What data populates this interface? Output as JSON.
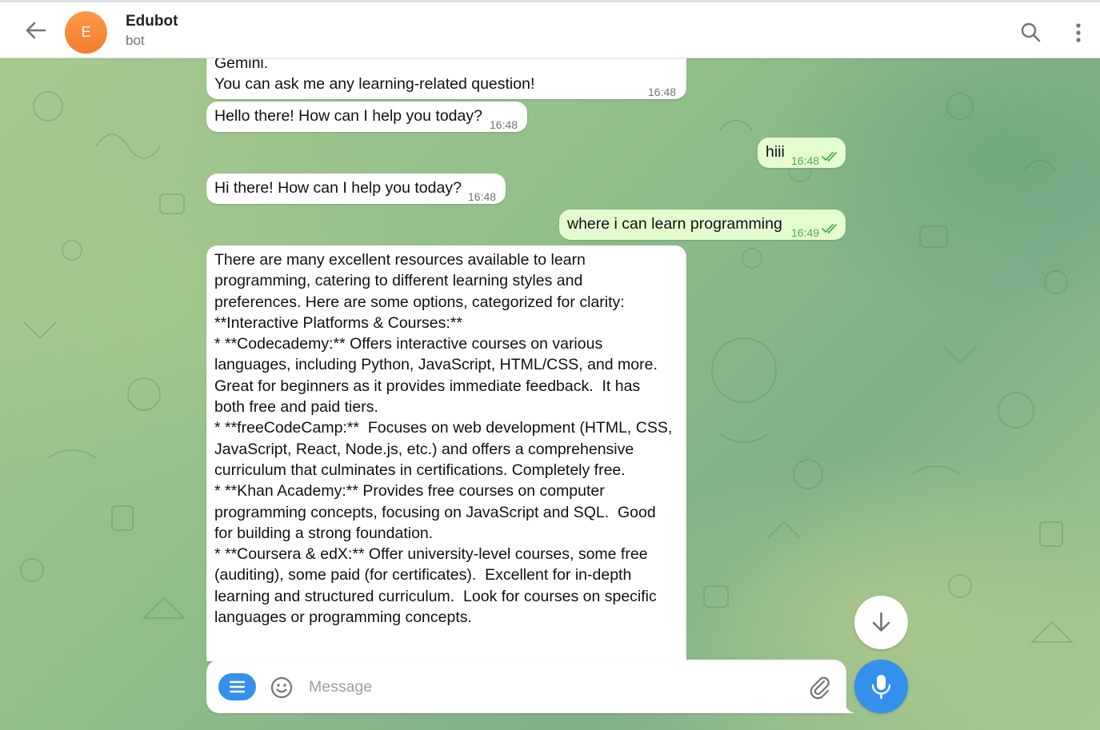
{
  "header": {
    "avatar_letter": "E",
    "title": "Edubot",
    "subtitle": "bot"
  },
  "messages": [
    {
      "direction": "incoming",
      "text_top": "Gemini.",
      "text": "You can ask me any learning-related question!",
      "time": "16:48"
    },
    {
      "direction": "incoming",
      "text": "Hello there! How can I help you today?",
      "time": "16:48"
    },
    {
      "direction": "outgoing",
      "text": "hiii",
      "time": "16:48",
      "status": "read"
    },
    {
      "direction": "incoming",
      "text": "Hi there! How can I help you today?",
      "time": "16:48"
    },
    {
      "direction": "outgoing",
      "text": "where i can learn programming",
      "time": "16:49",
      "status": "read"
    },
    {
      "direction": "incoming",
      "lines": [
        "There are many excellent resources available to learn",
        "programming, catering to different learning styles and",
        "preferences. Here are some options, categorized for clarity:",
        "",
        "**Interactive Platforms & Courses:**",
        "",
        "* **Codecademy:** Offers interactive courses on various",
        "languages, including Python, JavaScript, HTML/CSS, and more.",
        "Great for beginners as it provides immediate feedback.  It has",
        "both free and paid tiers.",
        "* **freeCodeCamp:**  Focuses on web development (HTML, CSS,",
        "JavaScript, React, Node.js, etc.) and offers a comprehensive",
        "curriculum that culminates in certifications. Completely free.",
        "* **Khan Academy:** Provides free courses on computer",
        "programming concepts, focusing on JavaScript and SQL.  Good",
        "for building a strong foundation.",
        "* **Coursera & edX:** Offer university-level courses, some free",
        "(auditing), some paid (for certificates).  Excellent for in-depth",
        "learning and structured curriculum.  Look for courses on specific",
        "languages or programming concepts."
      ]
    }
  ],
  "composer": {
    "placeholder": "Message"
  },
  "icons": {
    "back": "arrow-left-icon",
    "search": "search-icon",
    "more": "more-vertical-icon",
    "bot_menu": "menu-lines-icon",
    "emoji": "smile-icon",
    "attach": "paperclip-icon",
    "mic": "microphone-icon",
    "scroll_down": "arrow-down-icon"
  },
  "colors": {
    "accent": "#3390ec",
    "avatar": "#f27c2f",
    "outgoing_bubble": "#e3fcd0",
    "read_ticks": "#4fae4e"
  }
}
